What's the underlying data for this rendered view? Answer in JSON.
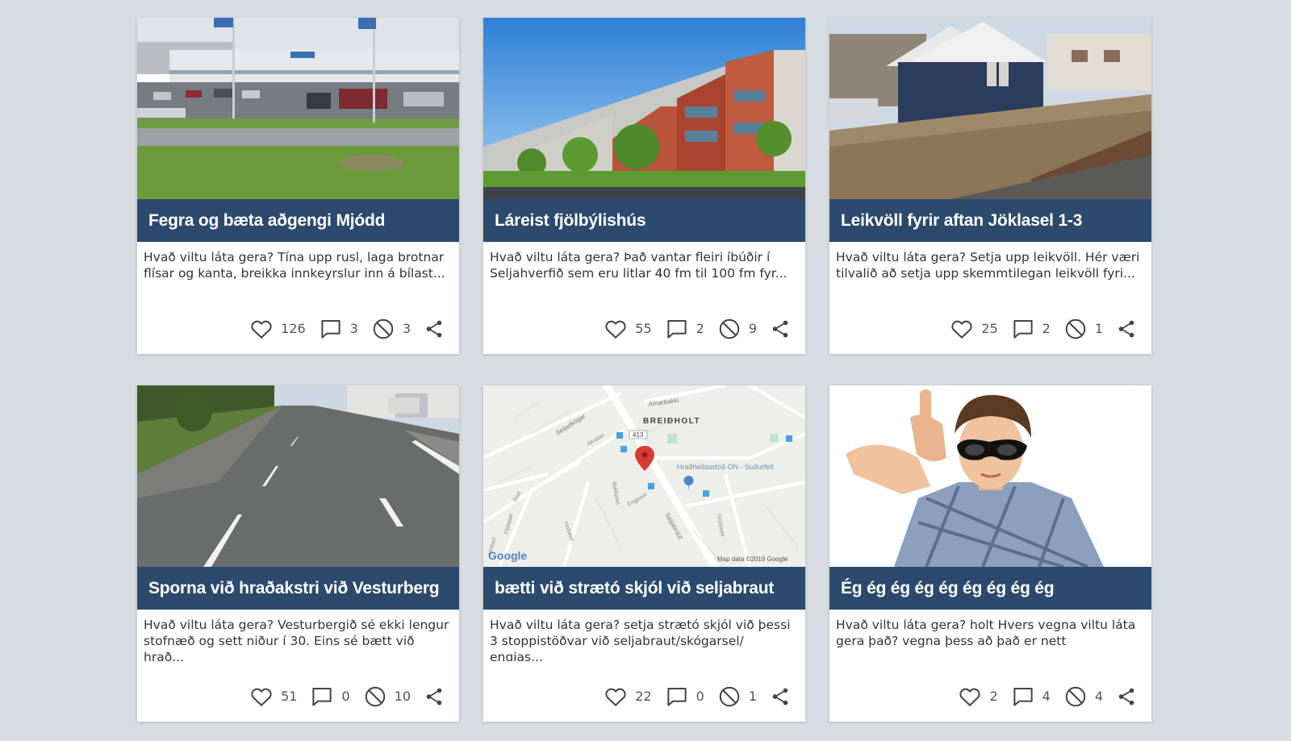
{
  "colors": {
    "background": "#d7dde2",
    "title_bar": "#2c4a6e",
    "card": "#ffffff",
    "icon": "#444444"
  },
  "cards": [
    {
      "image": "parking-lot-photo",
      "title": "Fegra og bæta aðgengi Mjódd",
      "description": "Hvað viltu láta gera? Tína upp rusl, laga brotnar flísar og kanta, breikka innkeyrslur inn á bílast...",
      "likes": "126",
      "comments": "3",
      "dislikes": "3"
    },
    {
      "image": "apartment-building-photo",
      "title": "Láreist fjölbýlishús",
      "description": "Hvað viltu láta gera? Það vantar fleiri íbúðir í Seljahverfið sem eru litlar 40 fm til 100 fm fyr...",
      "likes": "55",
      "comments": "2",
      "dislikes": "9"
    },
    {
      "image": "empty-lot-photo",
      "title": "Leikvöll fyrir aftan Jöklasel 1-3",
      "description": "Hvað viltu láta gera? Setja upp leikvöll. Hér væri tilvalið að setja upp skemmtilegan leikvöll fyri...",
      "likes": "25",
      "comments": "2",
      "dislikes": "1"
    },
    {
      "image": "road-photo",
      "title": "Sporna við hraðakstri við Vesturberg",
      "description": "Hvað viltu láta gera? Vesturbergið sé ekki lengur stofnæð og sett niður í 30. Eins sé bætt við hrað...",
      "likes": "51",
      "comments": "0",
      "dislikes": "10"
    },
    {
      "image": "map",
      "title": "bætti við strætó skjól við seljabraut",
      "description": "Hvað viltu láta gera? setja strætó skjól við þessi 3 stoppistöðvar við seljabraut/skógarsel/ engjas...",
      "likes": "22",
      "comments": "0",
      "dislikes": "1",
      "map": {
        "district": "BREIÐHOLT",
        "clinic": "Hraðheilsustöð ON - Suðurfell",
        "streets": [
          "Amarbakki",
          "Seljaskógar",
          "Seljabraut",
          "Engjasel",
          "Bakkasel",
          "Akrasel",
          "Ásel",
          "Holtasel",
          "Fljótasel",
          "Grjótasel",
          "Hnitsel"
        ],
        "route_number": "413",
        "attribution": "Map data ©2019 Google",
        "logo": "Google"
      }
    },
    {
      "image": "boy-thumbs-down-photo",
      "title": "Ég ég ég ég ég ég ég ég ég",
      "description": "Hvað viltu láta gera? holt  Hvers vegna viltu láta gera það? vegna þess að það er nett",
      "likes": "2",
      "comments": "4",
      "dislikes": "4"
    }
  ]
}
